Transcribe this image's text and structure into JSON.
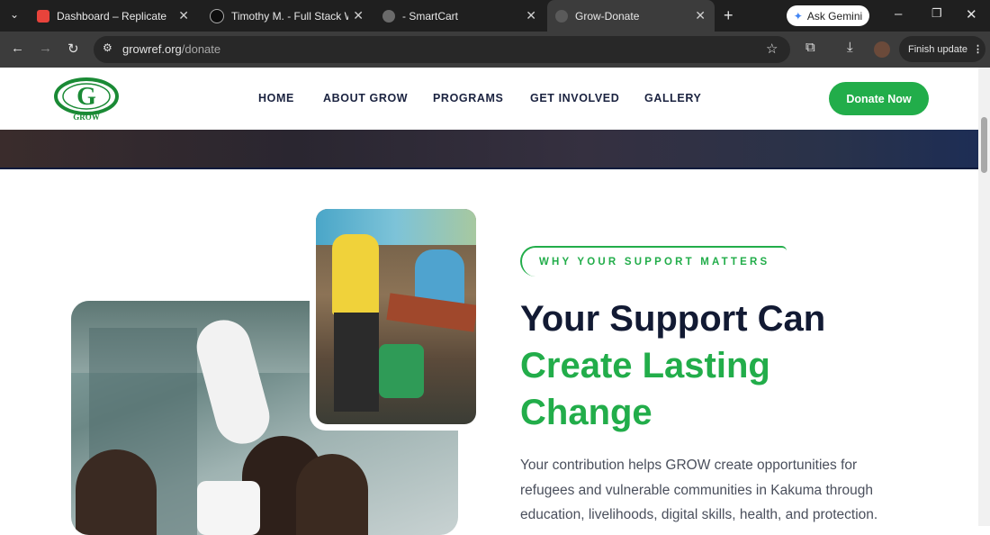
{
  "browser": {
    "tabs": [
      {
        "title": "Dashboard – Replicate"
      },
      {
        "title": "Timothy M. - Full Stack Web"
      },
      {
        "title": "- SmartCart"
      },
      {
        "title": "Grow-Donate"
      }
    ],
    "url_host": "growref.org",
    "url_path": "/donate",
    "gemini_label": "Ask Gemini",
    "finish_update_label": "Finish update"
  },
  "site": {
    "logo_text": "GROW",
    "nav": [
      "HOME",
      "ABOUT GROW",
      "PROGRAMS",
      "GET INVOLVED",
      "GALLERY"
    ],
    "donate_button": "Donate Now"
  },
  "section": {
    "eyebrow": "WHY YOUR SUPPORT MATTERS",
    "heading_line1": "Your Support Can",
    "heading_line2": "Create Lasting",
    "heading_line3": "Change",
    "paragraph": "Your contribution helps GROW create opportunities for refugees and vulnerable communities in Kakuma through education, livelihoods, digital skills, health, and protection."
  },
  "colors": {
    "brand_green": "#22ad4a",
    "heading_navy": "#121a33"
  }
}
